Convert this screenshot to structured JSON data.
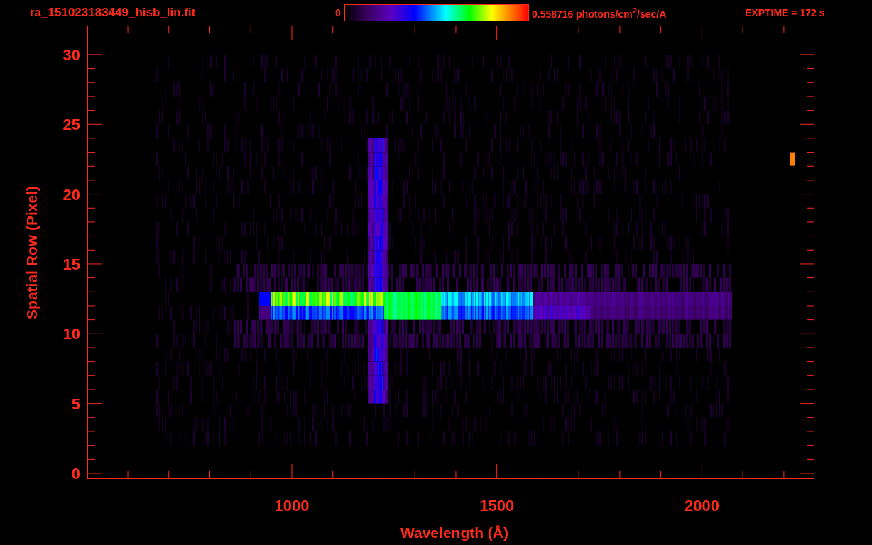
{
  "header": {
    "title": "ra_151023183449_hisb_lin.fit",
    "colorbar": {
      "min_label": "0",
      "max_label": "0.558716 photons/cm$^{2}$/sec/A"
    },
    "exposure": "EXPTIME = 172 s"
  },
  "plot": {
    "ylabel": "Spatial Row (Pixel)",
    "xlabel": "Wavelength (Å)",
    "yticks": [
      "30",
      "25",
      "20",
      "15",
      "10",
      "5",
      "0"
    ],
    "xticks": [
      "1000",
      "1500",
      "2000"
    ]
  }
}
